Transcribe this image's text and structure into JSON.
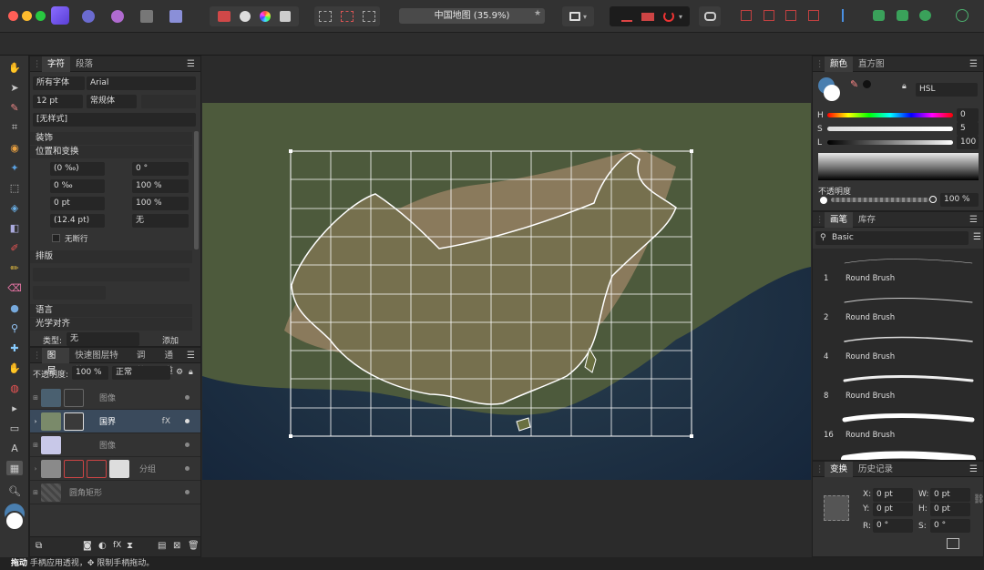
{
  "window": {
    "title": "中国地图 (35.9%)",
    "close_color": "#ff5f57",
    "min_color": "#febc2e",
    "max_color": "#28c840",
    "accent": "#7b5cff"
  },
  "character_panel": {
    "tabs": [
      "字符",
      "段落"
    ],
    "font_collection": "所有字体",
    "font_name": "Arial",
    "font_size": "12 pt",
    "font_style": "常规体",
    "style": "[无样式]",
    "sections": {
      "decoration": "装饰",
      "position": "位置和变换",
      "layout": "排版",
      "language": "语言",
      "optical": "光学对齐"
    },
    "fields": {
      "r1a": "(0 ‰)",
      "r1b": "0 °",
      "r2a": "0 ‰",
      "r2b": "100 %",
      "r3a": "0 pt",
      "r3b": "100 %",
      "r4a": "(12.4 pt)",
      "r4b": "无"
    },
    "nobreak": "无断行",
    "type_label": "类型:",
    "type_value": "无",
    "add_label": "添加"
  },
  "layers_panel": {
    "tabs": [
      "图层",
      "快速图层特效",
      "调整",
      "通道"
    ],
    "opacity_label": "不透明度:",
    "opacity_value": "100 %",
    "blend": "正常",
    "layers": [
      {
        "name": "图像",
        "selected": false
      },
      {
        "name": "国界",
        "selected": true,
        "fx": "fX"
      },
      {
        "name": "图像",
        "selected": false
      },
      {
        "name": "分组",
        "selected": false
      },
      {
        "name": "圆角矩形",
        "selected": false
      }
    ]
  },
  "color_panel": {
    "tabs": [
      "颜色",
      "直方图"
    ],
    "mode": "HSL",
    "h_label": "H",
    "h_value": "0",
    "s_label": "S",
    "s_value": "5",
    "l_label": "L",
    "l_value": "100",
    "opacity_label": "不透明度",
    "opacity_value": "100 %"
  },
  "brush_panel": {
    "tabs": [
      "画笔",
      "库存"
    ],
    "category": "Basic",
    "brushes": [
      {
        "size": "1",
        "name": "Round Brush",
        "thickness": 0.5
      },
      {
        "size": "2",
        "name": "Round Brush",
        "thickness": 1
      },
      {
        "size": "4",
        "name": "Round Brush",
        "thickness": 1.6
      },
      {
        "size": "8",
        "name": "Round Brush",
        "thickness": 3
      },
      {
        "size": "16",
        "name": "Round Brush",
        "thickness": 5
      }
    ]
  },
  "transform_panel": {
    "tabs": [
      "变换",
      "历史记录"
    ],
    "x_label": "X:",
    "x_value": "0 pt",
    "y_label": "Y:",
    "y_value": "0 pt",
    "w_label": "W:",
    "w_value": "0 pt",
    "h_label": "H:",
    "h_value": "0 pt",
    "r_label": "R:",
    "r_value": "0 °",
    "s_label": "S:",
    "s_value": "0 °"
  },
  "status": {
    "drag": "拖动",
    "text": "手柄应用透视，✥ 限制手柄拖动。"
  }
}
